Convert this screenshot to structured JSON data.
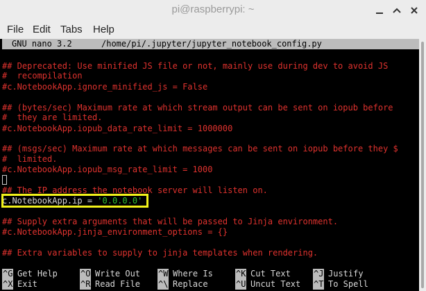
{
  "window": {
    "title": "pi@raspberrypi: ~"
  },
  "menu": {
    "file": "File",
    "edit": "Edit",
    "tabs": "Tabs",
    "help": "Help"
  },
  "nano": {
    "version": "GNU nano 3.2",
    "filepath": "/home/pi/.jupyter/jupyter_notebook_config.py"
  },
  "lines": [
    "## Deprecated: Use minified JS file or not, mainly use during dev to avoid JS",
    "#  recompilation",
    "#c.NotebookApp.ignore_minified_js = False",
    "## (bytes/sec) Maximum rate at which stream output can be sent on iopub before",
    "#  they are limited.",
    "#c.NotebookApp.iopub_data_rate_limit = 1000000",
    "## (msgs/sec) Maximum rate at which messages can be sent on iopub before they $",
    "#  limited.",
    "#c.NotebookApp.iopub_msg_rate_limit = 1000",
    "## The IP address the notebook server will listen on.",
    "## Supply extra arguments that will be passed to Jinja environment.",
    "#c.NotebookApp.jinja_environment_options = {}",
    "## Extra variables to supply to jinja templates when rendering."
  ],
  "edited_line": {
    "prefix": "c.NotebookApp.ip = ",
    "value": "'0.0.0.0'"
  },
  "shortcuts": [
    {
      "key": "^G",
      "label": "Get Help"
    },
    {
      "key": "^O",
      "label": "Write Out"
    },
    {
      "key": "^W",
      "label": "Where Is"
    },
    {
      "key": "^K",
      "label": "Cut Text"
    },
    {
      "key": "^J",
      "label": "Justify"
    },
    {
      "key": "^X",
      "label": "Exit"
    },
    {
      "key": "^R",
      "label": "Read File"
    },
    {
      "key": "^\\",
      "label": "Replace"
    },
    {
      "key": "^U",
      "label": "Uncut Text"
    },
    {
      "key": "^T",
      "label": "To Spell"
    }
  ],
  "colors": {
    "comment": "#e0322e",
    "string": "#2ec22e",
    "highlight_box": "#f2f21a",
    "titlebar": "#ececec"
  }
}
